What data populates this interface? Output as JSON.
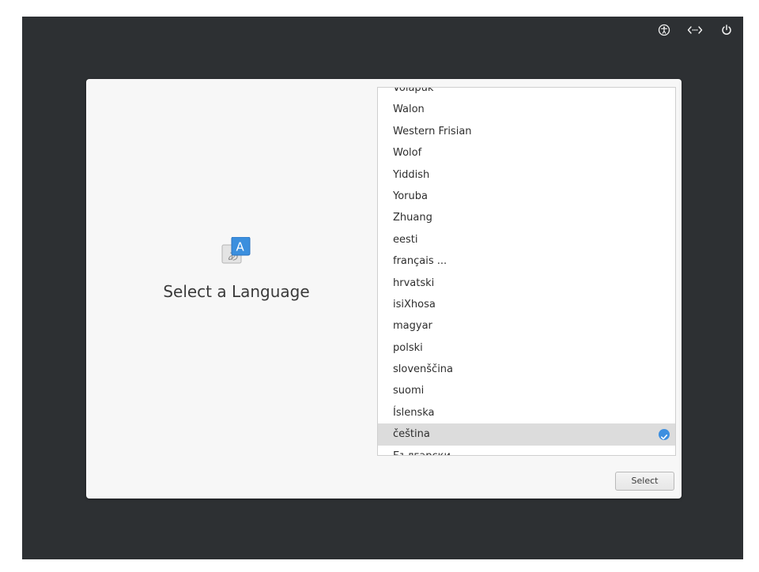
{
  "topbar": {
    "accessibility_icon": "accessibility-icon",
    "network_icon": "network-icon",
    "power_icon": "power-icon"
  },
  "left": {
    "icon": "language-icon",
    "title": "Select a Language"
  },
  "languages": [
    "Volapük",
    "Walon",
    "Western Frisian",
    "Wolof",
    "Yiddish",
    "Yoruba",
    "Zhuang",
    "eesti",
    "français ...",
    "hrvatski",
    "isiXhosa",
    "magyar",
    "polski",
    "slovenščina",
    "suomi",
    "Íslenska",
    "čeština",
    "Български"
  ],
  "selected_language": "čeština",
  "select_button": {
    "label": "Select"
  },
  "colors": {
    "background": "#2d3033",
    "dialog": "#f7f7f7",
    "selected_row": "#dcdcdc",
    "check": "#3d8fe0",
    "icon_accent": "#3b8fde"
  }
}
